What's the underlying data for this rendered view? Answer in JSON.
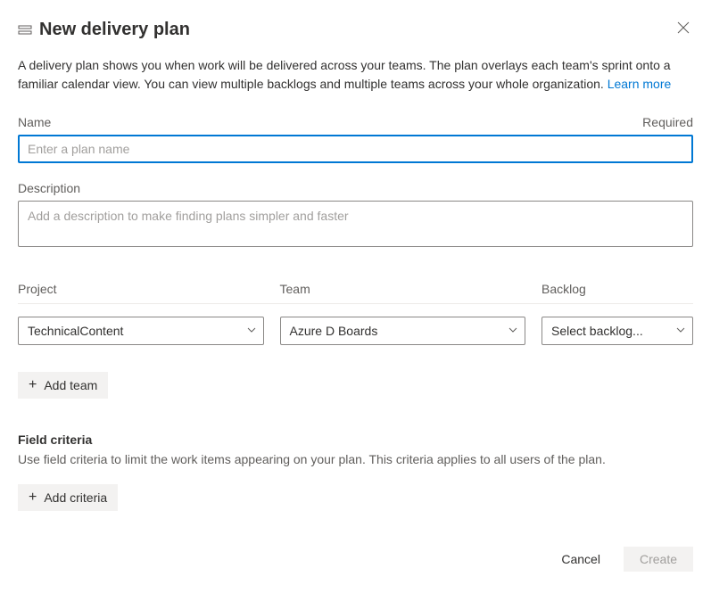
{
  "header": {
    "title": "New delivery plan"
  },
  "intro": {
    "text": "A delivery plan shows you when work will be delivered across your teams. The plan overlays each team's sprint onto a familiar calendar view. You can view multiple backlogs and multiple teams across your whole organization. ",
    "learn_more": "Learn more"
  },
  "name_field": {
    "label": "Name",
    "required": "Required",
    "placeholder": "Enter a plan name",
    "value": ""
  },
  "description_field": {
    "label": "Description",
    "placeholder": "Add a description to make finding plans simpler and faster",
    "value": ""
  },
  "columns": {
    "project_label": "Project",
    "team_label": "Team",
    "backlog_label": "Backlog"
  },
  "row": {
    "project": "TechnicalContent",
    "team": "Azure D Boards",
    "backlog": "Select backlog..."
  },
  "add_team_label": "Add team",
  "field_criteria": {
    "heading": "Field criteria",
    "description": "Use field criteria to limit the work items appearing on your plan. This criteria applies to all users of the plan."
  },
  "add_criteria_label": "Add criteria",
  "footer": {
    "cancel": "Cancel",
    "create": "Create"
  }
}
